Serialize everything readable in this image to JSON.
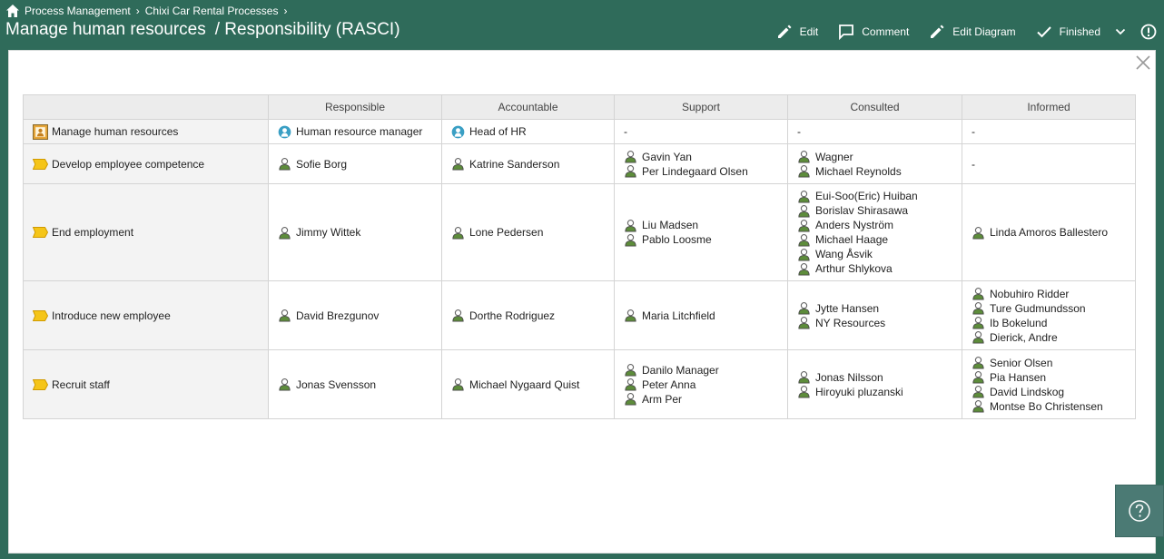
{
  "breadcrumb": [
    "Process Management",
    "Chixi Car Rental Processes"
  ],
  "title": {
    "main": "Manage human resources",
    "sub": "/ Responsibility (RASCI)"
  },
  "toolbar": {
    "edit": "Edit",
    "comment": "Comment",
    "edit_diagram": "Edit Diagram",
    "finished": "Finished"
  },
  "table": {
    "headers": [
      "",
      "Responsible",
      "Accountable",
      "Support",
      "Consulted",
      "Informed"
    ],
    "rows": [
      {
        "process": "Manage human resources",
        "responsible": "Human resource manager",
        "accountable": "Head of HR",
        "support": "-",
        "consulted": "-",
        "informed": "-"
      },
      {
        "process": "Develop employee competence",
        "responsible": "Sofie Borg",
        "accountable": "Katrine Sanderson",
        "support": [
          "Gavin Yan",
          "Per Lindegaard Olsen"
        ],
        "consulted": [
          "Wagner",
          "Michael Reynolds"
        ],
        "informed": "-"
      },
      {
        "process": "End employment",
        "responsible": "Jimmy Wittek",
        "accountable": "Lone Pedersen",
        "support": [
          "Liu Madsen",
          "Pablo Loosme"
        ],
        "consulted": [
          "Eui-Soo(Eric) Huiban",
          "Borislav Shirasawa",
          "Anders Nyström",
          "Michael Haage",
          "Wang Åsvik",
          "Arthur Shlykova"
        ],
        "informed": [
          "Linda Amoros Ballestero"
        ]
      },
      {
        "process": "Introduce new employee",
        "responsible": "David Brezgunov",
        "accountable": "Dorthe Rodriguez",
        "support": [
          "Maria Litchfield"
        ],
        "consulted": [
          "Jytte Hansen",
          "NY Resources"
        ],
        "informed": [
          "Nobuhiro Ridder",
          "Ture Gudmundsson",
          "Ib Bokelund",
          "Dierick, Andre"
        ]
      },
      {
        "process": "Recruit staff",
        "responsible": "Jonas Svensson",
        "accountable": "Michael Nygaard Quist",
        "support": [
          "Danilo Manager",
          "Peter Anna",
          "Arm Per"
        ],
        "consulted": [
          "Jonas Nilsson",
          "Hiroyuki pluzanski"
        ],
        "informed": [
          "Senior Olsen",
          "Pia Hansen",
          "David Lindskog",
          "Montse Bo Christensen"
        ]
      }
    ]
  },
  "icons": {
    "home": "home-icon",
    "edit": "pencil-icon",
    "comment": "comment-icon",
    "finished": "check-icon",
    "more": "chevron-down-icon",
    "info": "exclamation-icon",
    "close": "close-icon",
    "help": "help-icon",
    "process_root": "process-map-icon",
    "process": "process-step-icon",
    "role": "role-icon",
    "person": "person-icon"
  },
  "colors": {
    "header": "#2f6b5a",
    "process_step": "#f5c518",
    "person": "#5d8c3b",
    "role": "#3a9fc4",
    "help": "#4b7a74"
  }
}
